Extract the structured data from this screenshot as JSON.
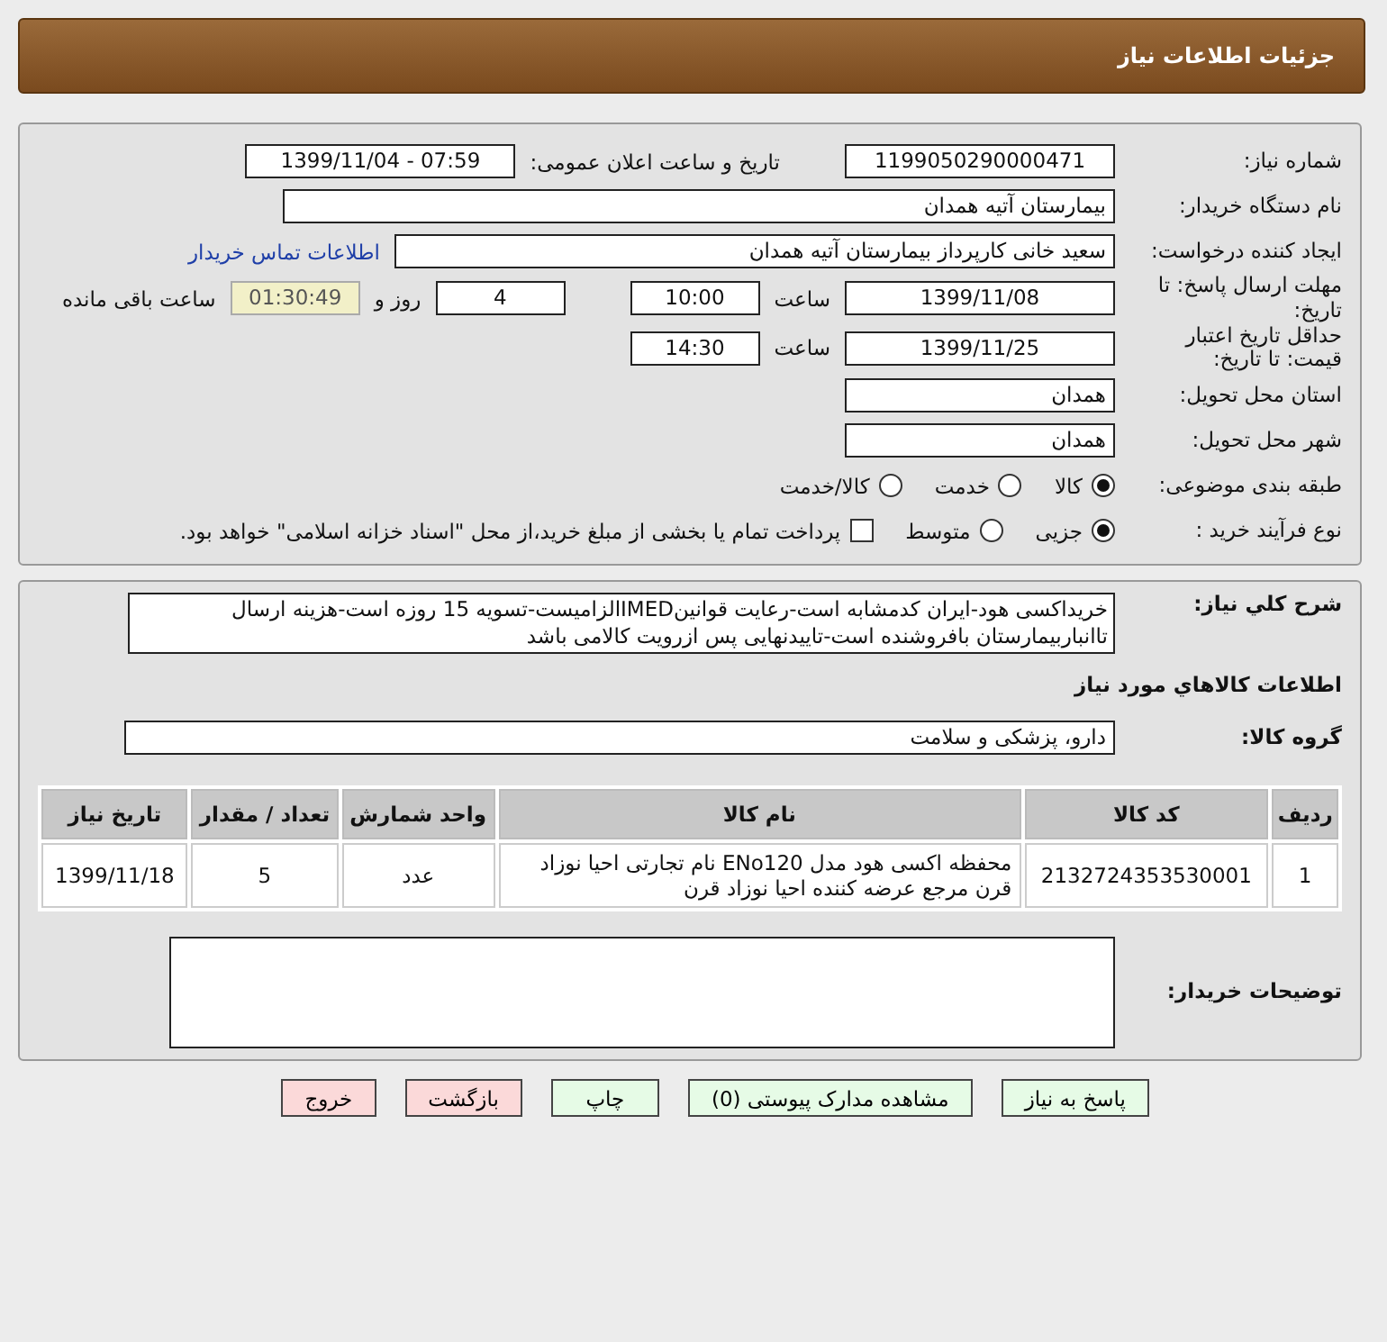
{
  "header": {
    "title": "جزئیات اطلاعات نیاز"
  },
  "need_number": {
    "label": "شماره نیاز:",
    "value": "1199050290000471"
  },
  "announce": {
    "label": "تاریخ و ساعت اعلان عمومی:",
    "value": "1399/11/04 - 07:59"
  },
  "buyer": {
    "label": "نام دستگاه خریدار:",
    "value": "بیمارستان آتیه همدان"
  },
  "creator": {
    "label": "ایجاد کننده درخواست:",
    "value": "سعید خانی کارپرداز بیمارستان آتیه همدان",
    "link": "اطلاعات تماس خریدار"
  },
  "deadline": {
    "label": "مهلت ارسال پاسخ: تا تاریخ:",
    "date": "1399/11/08",
    "time_label": "ساعت",
    "time": "10:00",
    "days": "4",
    "days_label": "روز و",
    "remaining": "01:30:49",
    "remaining_label": "ساعت باقی مانده"
  },
  "validity": {
    "label": "حداقل تاریخ اعتبار قیمت: تا تاریخ:",
    "date": "1399/11/25",
    "time_label": "ساعت",
    "time": "14:30"
  },
  "province": {
    "label": "استان محل تحویل:",
    "value": "همدان"
  },
  "city": {
    "label": "شهر محل تحویل:",
    "value": "همدان"
  },
  "category": {
    "label": "طبقه بندی موضوعی:",
    "options": [
      {
        "label": "کالا",
        "selected": true
      },
      {
        "label": "خدمت",
        "selected": false
      },
      {
        "label": "کالا/خدمت",
        "selected": false
      }
    ]
  },
  "process": {
    "label": "نوع فرآیند خرید :",
    "options": [
      {
        "label": "جزیی",
        "selected": true
      },
      {
        "label": "متوسط",
        "selected": false
      }
    ],
    "payment": {
      "label": "پرداخت تمام یا بخشی از مبلغ خرید،از محل \"اسناد خزانه اسلامی\" خواهد بود.",
      "checked": false
    }
  },
  "description": {
    "label": "شرح كلي نياز:",
    "text": "خریداکسی هود-ایران کدمشابه است-رعایت قوانینIMEDالزامیست-تسویه 15 روزه  است-هزینه ارسال تاانباربیمارستان بافروشنده است-تاییدنهایی پس ازرویت کالامی باشد"
  },
  "goods_title": "اطلاعات كالاهاي مورد نياز",
  "goods_group": {
    "label": "گروه كالا:",
    "value": "دارو، پزشکی و سلامت"
  },
  "table": {
    "columns": [
      "ردیف",
      "کد کالا",
      "نام کالا",
      "واحد شمارش",
      "تعداد / مقدار",
      "تاریخ نیاز"
    ],
    "rows": [
      [
        "1",
        "2132724353530001",
        "محفظه اکسی هود مدل ENo120 نام تجارتی احیا نوزاد قرن مرجع عرضه کننده احیا نوزاد قرن",
        "عدد",
        "5",
        "1399/11/18"
      ]
    ]
  },
  "buyer_notes": {
    "label": "توضیحات خریدار:"
  },
  "buttons": [
    {
      "label": "پاسخ به نیاز",
      "kind": "action"
    },
    {
      "label": "مشاهده مدارک پیوستی (0)",
      "kind": "action"
    },
    {
      "label": "چاپ",
      "kind": "action"
    },
    {
      "label": "بازگشت",
      "kind": "exit"
    },
    {
      "label": "خروج",
      "kind": "exit"
    }
  ]
}
